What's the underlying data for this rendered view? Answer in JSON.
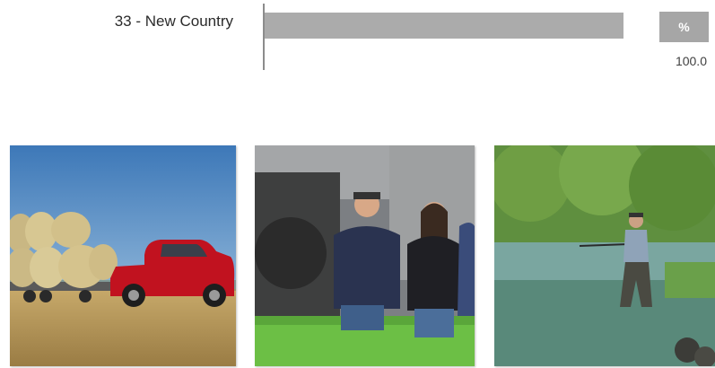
{
  "chart_data": {
    "type": "bar",
    "orientation": "horizontal",
    "categories": [
      "33 - New Country"
    ],
    "values": [
      100.0
    ],
    "value_header": "%",
    "value_labels": [
      "100.0"
    ],
    "xlim": [
      0,
      100
    ],
    "colors": {
      "bar": "#ababab",
      "axis": "#8c8c8c",
      "header": "#a6a6a6"
    }
  },
  "photos": [
    {
      "icon": "hay-bales-and-red-pickup-truck"
    },
    {
      "icon": "family-on-farm"
    },
    {
      "icon": "fly-fisherman-in-river"
    }
  ]
}
